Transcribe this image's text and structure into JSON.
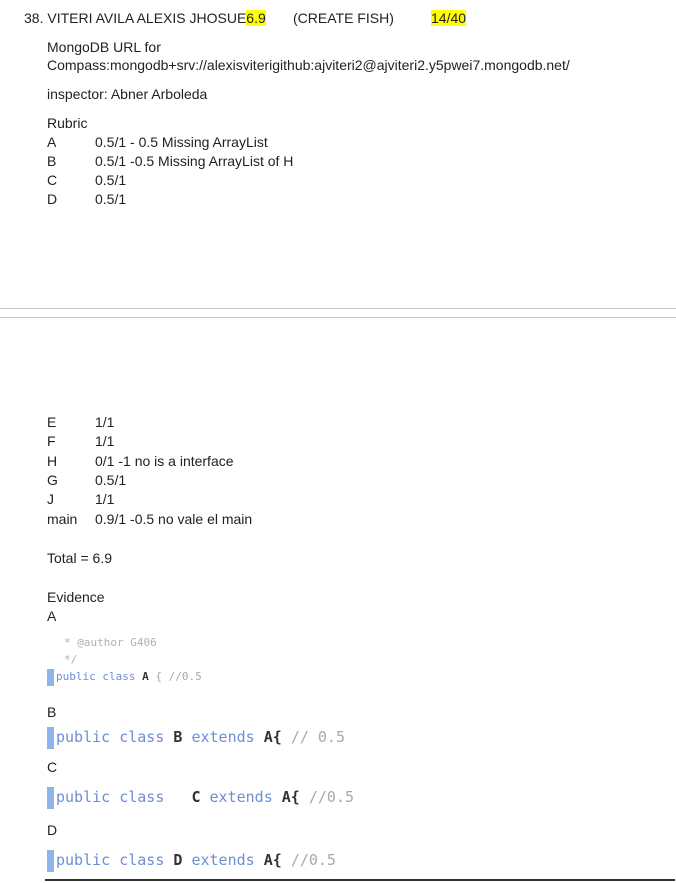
{
  "header": {
    "number": "38.",
    "student_name": "VITERI AVILA ALEXIS JHOSUE",
    "grade": "6.9",
    "assignment": "(CREATE FISH)",
    "position": "14/40"
  },
  "mongo": {
    "line1": "MongoDB URL for",
    "line2": "Compass:mongodb+srv://alexisviterigithub:ajviteri2@ajviteri2.y5pwei7.mongodb.net/"
  },
  "inspector": "inspector: Abner Arboleda",
  "rubric": {
    "title": "Rubric",
    "items_top": [
      {
        "key": "A",
        "value": "0.5/1 - 0.5 Missing ArrayList"
      },
      {
        "key": "B",
        "value": "0.5/1 -0.5 Missing ArrayList of H"
      },
      {
        "key": "C",
        "value": "0.5/1"
      },
      {
        "key": "D",
        "value": "0.5/1"
      }
    ],
    "items_bottom": [
      {
        "key": "E",
        "value": "1/1"
      },
      {
        "key": "F",
        "value": "1/1"
      },
      {
        "key": "H",
        "value": "0/1 -1 no is a interface"
      },
      {
        "key": "G",
        "value": "0.5/1"
      },
      {
        "key": "J",
        "value": "1/1"
      },
      {
        "key": "main",
        "value": "0.9/1 -0.5 no vale el main"
      }
    ]
  },
  "total": "Total =  6.9",
  "evidence": {
    "title": "Evidence",
    "a": {
      "label": "A",
      "line1": "* @author G406",
      "line2": "*/",
      "kw": "public class",
      "cls": "A",
      "brace": "{",
      "comment": "//0.5"
    },
    "b": {
      "label": "B",
      "kw": "public class",
      "cls": "B",
      "kw2": "extends",
      "cls2": "A{",
      "comment": "// 0.5"
    },
    "c": {
      "label": "C",
      "kw": "public class",
      "cls": "C",
      "kw2": "extends",
      "cls2": "A{",
      "comment": "//0.5"
    },
    "d": {
      "label": "D",
      "kw": "public class",
      "cls": "D",
      "kw2": "extends",
      "cls2": "A{",
      "comment": "//0.5"
    }
  }
}
